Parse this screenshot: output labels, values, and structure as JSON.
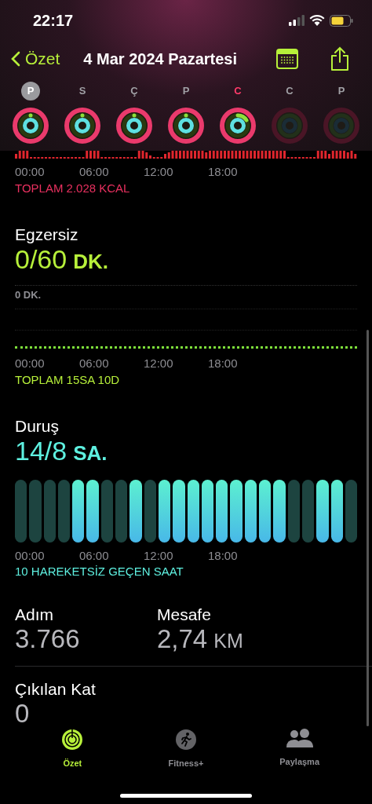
{
  "status_bar": {
    "time": "22:17"
  },
  "nav": {
    "back": "Özet",
    "title": "4 Mar 2024 Pazartesi"
  },
  "days": [
    {
      "label": "P",
      "selected": true,
      "today": false,
      "kind": "rings"
    },
    {
      "label": "S",
      "selected": false,
      "today": false,
      "kind": "rings"
    },
    {
      "label": "Ç",
      "selected": false,
      "today": false,
      "kind": "rings"
    },
    {
      "label": "P",
      "selected": false,
      "today": false,
      "kind": "rings"
    },
    {
      "label": "C",
      "selected": false,
      "today": true,
      "kind": "rings"
    },
    {
      "label": "C",
      "selected": false,
      "today": false,
      "kind": "empty"
    },
    {
      "label": "P",
      "selected": false,
      "today": false,
      "kind": "empty"
    }
  ],
  "move": {
    "axis": [
      "00:00",
      "06:00",
      "12:00",
      "18:00"
    ],
    "total": "TOPLAM 2.028 KCAL"
  },
  "exercise": {
    "title": "Egzersiz",
    "value": "0/60",
    "unit": "DK.",
    "scale": "0 DK.",
    "axis": [
      "00:00",
      "06:00",
      "12:00",
      "18:00"
    ],
    "total": "TOPLAM 15SA 10D"
  },
  "stand": {
    "title": "Duruş",
    "value": "14/8",
    "unit": "SA.",
    "hours": [
      {
        "stood": false
      },
      {
        "stood": false
      },
      {
        "stood": false
      },
      {
        "stood": false
      },
      {
        "stood": true
      },
      {
        "stood": true
      },
      {
        "stood": false
      },
      {
        "stood": false
      },
      {
        "stood": true
      },
      {
        "stood": false
      },
      {
        "stood": true
      },
      {
        "stood": true
      },
      {
        "stood": true
      },
      {
        "stood": true
      },
      {
        "stood": true
      },
      {
        "stood": true
      },
      {
        "stood": true
      },
      {
        "stood": true
      },
      {
        "stood": true
      },
      {
        "stood": false
      },
      {
        "stood": false
      },
      {
        "stood": true
      },
      {
        "stood": true
      },
      {
        "stood": false
      }
    ],
    "axis": [
      "00:00",
      "06:00",
      "12:00",
      "18:00"
    ],
    "total": "10 HAREKETSİZ GEÇEN SAAT"
  },
  "stats": [
    {
      "label": "Adım",
      "value": "3.766"
    },
    {
      "label": "Mesafe",
      "value": "2,74",
      "unit": "KM"
    }
  ],
  "floors": {
    "label": "Çıkılan Kat",
    "value": "0"
  },
  "tabs": [
    {
      "label": "Özet",
      "selected": true,
      "kind": "summary"
    },
    {
      "label": "Fitness+",
      "selected": false,
      "kind": "fitness"
    },
    {
      "label": "Paylaşma",
      "selected": false,
      "kind": "sharing"
    }
  ]
}
